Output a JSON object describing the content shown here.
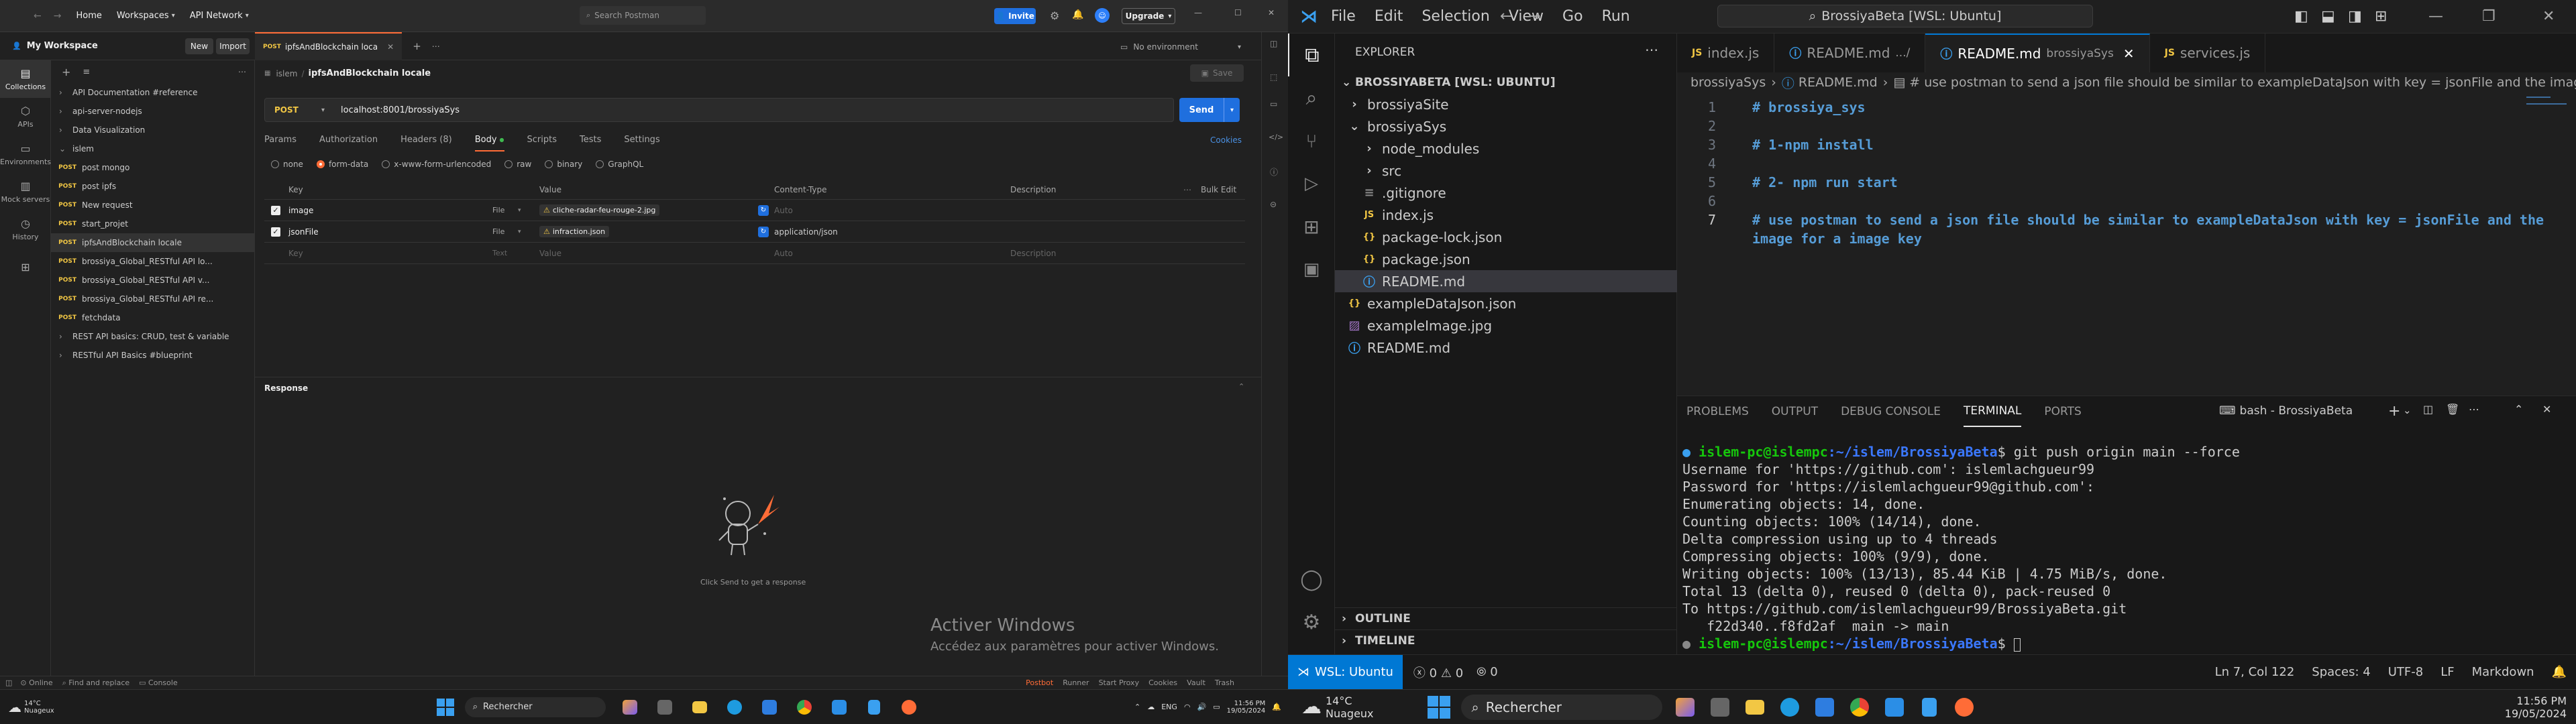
{
  "postman": {
    "nav": {
      "home": "Home",
      "workspaces": "Workspaces",
      "api_network": "API Network",
      "search_placeholder": "Search Postman",
      "invite": "Invite",
      "upgrade": "Upgrade"
    },
    "workspace": {
      "title": "My Workspace",
      "new_button": "New",
      "import_button": "Import"
    },
    "rail": [
      "Collections",
      "APIs",
      "Environments",
      "Mock servers",
      "History"
    ],
    "collections": [
      {
        "name": "API Documentation #reference",
        "level": 0,
        "arrow": "›"
      },
      {
        "name": "api-server-nodejs",
        "level": 0,
        "arrow": "›"
      },
      {
        "name": "Data Visualization",
        "level": 0,
        "arrow": "›"
      },
      {
        "name": "islem",
        "level": 0,
        "arrow": "⌄"
      },
      {
        "name": "post mongo",
        "level": 1,
        "method": "POST"
      },
      {
        "name": "post ipfs",
        "level": 1,
        "method": "POST"
      },
      {
        "name": "New request",
        "level": 1,
        "method": "POST"
      },
      {
        "name": "start_projet",
        "level": 1,
        "method": "POST"
      },
      {
        "name": "ipfsAndBlockchain locale",
        "level": 1,
        "method": "POST",
        "selected": true
      },
      {
        "name": "brossiya_Global_RESTful API lo...",
        "level": 1,
        "method": "POST"
      },
      {
        "name": "brossiya_Global_RESTful API v...",
        "level": 1,
        "method": "POST"
      },
      {
        "name": "brossiya_Global_RESTful API re...",
        "level": 1,
        "method": "POST"
      },
      {
        "name": "fetchdata",
        "level": 1,
        "method": "POST"
      },
      {
        "name": "REST API basics: CRUD, test & variable",
        "level": 0,
        "arrow": "›"
      },
      {
        "name": "RESTful API Basics #blueprint",
        "level": 0,
        "arrow": "›"
      }
    ],
    "tab": {
      "method": "POST",
      "label": "ipfsAndBlockchain loca"
    },
    "environment": "No environment",
    "breadcrumb": {
      "parent": "islem",
      "current": "ipfsAndBlockchain locale",
      "save": "Save"
    },
    "request": {
      "method": "POST",
      "url": "localhost:8001/brossiyaSys",
      "send": "Send"
    },
    "request_tabs": [
      "Params",
      "Authorization",
      "Headers (8)",
      "Body",
      "Scripts",
      "Tests",
      "Settings"
    ],
    "cookies": "Cookies",
    "body_types": [
      "none",
      "form-data",
      "x-www-form-urlencoded",
      "raw",
      "binary",
      "GraphQL"
    ],
    "table": {
      "headers": [
        "Key",
        "Value",
        "Content-Type",
        "Description"
      ],
      "bulk_edit": "Bulk Edit",
      "rows": [
        {
          "key": "image",
          "type": "File",
          "value": "cliche-radar-feu-rouge-2.jpg",
          "content_type": "Auto",
          "description": ""
        },
        {
          "key": "jsonFile",
          "type": "File",
          "value": "infraction.json",
          "content_type": "application/json",
          "description": ""
        }
      ],
      "placeholder": {
        "key": "Key",
        "type": "Text",
        "value": "Value",
        "content_type": "Auto",
        "description": "Description"
      }
    },
    "response": {
      "title": "Response",
      "empty_text": "Click Send to get a response"
    },
    "watermark": {
      "title": "Activer Windows",
      "subtitle": "Accédez aux paramètres pour activer Windows."
    },
    "status": [
      "Online",
      "Find and replace",
      "Console"
    ],
    "status_right": [
      "Postbot",
      "Runner",
      "Start Proxy",
      "Cookies",
      "Vault",
      "Trash"
    ]
  },
  "vscode": {
    "menu": [
      "File",
      "Edit",
      "Selection",
      "View",
      "Go",
      "Run"
    ],
    "search": "BrossiyaBeta [WSL: Ubuntu]",
    "explorer": {
      "title": "EXPLORER",
      "root": "BROSSIYABETA [WSL: UBUNTU]",
      "items": [
        {
          "name": "brossiyaSite",
          "level": 0,
          "kind": "folder-closed"
        },
        {
          "name": "brossiyaSys",
          "level": 0,
          "kind": "folder-open"
        },
        {
          "name": "node_modules",
          "level": 1,
          "kind": "folder-closed"
        },
        {
          "name": "src",
          "level": 1,
          "kind": "folder-closed"
        },
        {
          "name": ".gitignore",
          "level": 1,
          "kind": "file"
        },
        {
          "name": "index.js",
          "level": 1,
          "kind": "js"
        },
        {
          "name": "package-lock.json",
          "level": 1,
          "kind": "json"
        },
        {
          "name": "package.json",
          "level": 1,
          "kind": "json"
        },
        {
          "name": "README.md",
          "level": 1,
          "kind": "info",
          "selected": true
        },
        {
          "name": "exampleDataJson.json",
          "level": 0,
          "kind": "json"
        },
        {
          "name": "exampleImage.jpg",
          "level": 0,
          "kind": "image"
        },
        {
          "name": "README.md",
          "level": 0,
          "kind": "info"
        }
      ],
      "outline": "OUTLINE",
      "timeline": "TIMELINE"
    },
    "tabs": [
      {
        "label": "index.js",
        "desc": "",
        "kind": "js"
      },
      {
        "label": "README.md",
        "desc": ".../",
        "kind": "info"
      },
      {
        "label": "README.md",
        "desc": "brossiyaSys",
        "kind": "info",
        "active": true
      },
      {
        "label": "services.js",
        "desc": "",
        "kind": "js"
      }
    ],
    "breadcrumb": [
      "brossiyaSys",
      "README.md",
      "# use postman to send a json file should be similar to exampleDataJson with key = jsonFile and the image for a image key"
    ],
    "code": [
      {
        "n": "1",
        "text": "# brossiya_sys"
      },
      {
        "n": "2",
        "text": ""
      },
      {
        "n": "3",
        "text": "# 1-npm install"
      },
      {
        "n": "4",
        "text": ""
      },
      {
        "n": "5",
        "text": "# 2- npm run start"
      },
      {
        "n": "6",
        "text": ""
      },
      {
        "n": "7",
        "text": "# use postman to send a json file should be similar to exampleDataJson with key = jsonFile and the"
      },
      {
        "n": "",
        "text": "image for a image key"
      }
    ],
    "panel_tabs": [
      "PROBLEMS",
      "OUTPUT",
      "DEBUG CONSOLE",
      "TERMINAL",
      "PORTS"
    ],
    "terminal_name": "bash - BrossiyaBeta",
    "terminal": {
      "prompt1": "islem-pc@islempc",
      "path1": ":~/islem/BrossiyaBeta",
      "cmd1": "$ git push origin main --force",
      "lines": [
        "Username for 'https://github.com': islemlachgueur99",
        "Password for 'https://islemlachgueur99@github.com':",
        "Enumerating objects: 14, done.",
        "Counting objects: 100% (14/14), done.",
        "Delta compression using up to 4 threads",
        "Compressing objects: 100% (9/9), done.",
        "Writing objects: 100% (13/13), 85.44 KiB | 4.75 MiB/s, done.",
        "Total 13 (delta 0), reused 0 (delta 0), pack-reused 0",
        "To https://github.com/islemlachgueur99/BrossiyaBeta.git",
        "   f22d340..f8fd2af  main -> main"
      ],
      "prompt2": "islem-pc@islempc",
      "path2": ":~/islem/BrossiyaBeta",
      "cmd2": "$ "
    },
    "status": {
      "remote": "WSL: Ubuntu",
      "errors": "0",
      "warnings": "0",
      "ports": "0",
      "position": "Ln 7, Col 122",
      "spaces": "Spaces: 4",
      "encoding": "UTF-8",
      "eol": "LF",
      "language": "Markdown"
    }
  },
  "taskbar_left": {
    "weather_temp": "14°C",
    "weather_desc": "Nuageux",
    "search": "Rechercher",
    "lang": "ENG",
    "time": "11:56 PM",
    "date": "19/05/2024"
  },
  "taskbar_right": {
    "weather_temp": "14°C",
    "weather_desc": "Nuageux",
    "search": "Rechercher",
    "time": "11:56 PM",
    "date": "19/05/2024"
  }
}
